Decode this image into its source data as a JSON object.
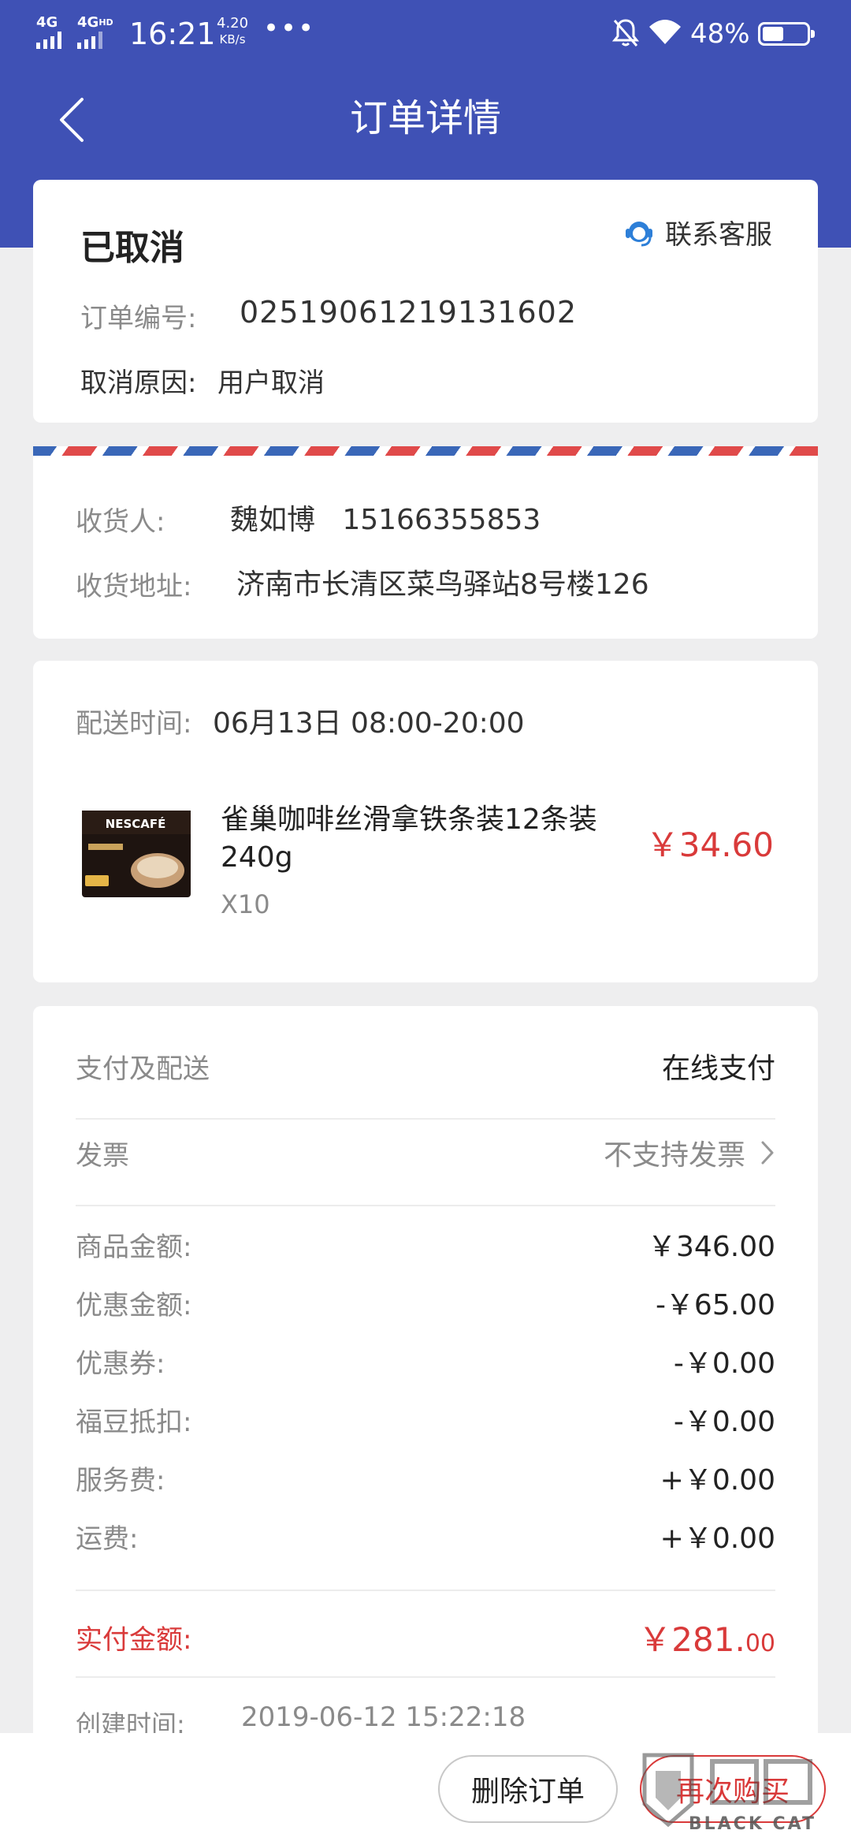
{
  "status_bar": {
    "network1": "4G",
    "network2": "4G",
    "network2_sup": "HD",
    "time": "16:21",
    "speed_value": "4.20",
    "speed_unit": "KB/s",
    "more": "•••",
    "battery_percent": "48%",
    "battery_level": 0.48,
    "icons": [
      "signal-icon",
      "mute-icon",
      "wifi-icon",
      "battery-icon"
    ]
  },
  "nav": {
    "title": "订单详情",
    "back_icon": "chevron-left-icon"
  },
  "order": {
    "status": "已取消",
    "customer_service": "联系客服",
    "order_no_label": "订单编号:",
    "order_no": "02519061219131602",
    "cancel_reason_label": "取消原因:",
    "cancel_reason": "用户取消"
  },
  "address": {
    "receiver_label": "收货人:",
    "receiver": "魏如博   15166355853",
    "address_label": "收货地址:",
    "address": "济南市长清区菜鸟驿站8号楼126"
  },
  "product": {
    "delivery_label": "配送时间:",
    "delivery_time": "06月13日 08:00-20:00",
    "name": "雀巢咖啡丝滑拿铁条装12条装240g",
    "quantity": "X10",
    "price": "￥34.60",
    "thumb_brand": "NESCAFÉ"
  },
  "payment": {
    "pay_method_label": "支付及配送",
    "pay_method": "在线支付",
    "invoice_label": "发票",
    "invoice": "不支持发票",
    "items": [
      {
        "label": "商品金额:",
        "value": "￥346.00"
      },
      {
        "label": "优惠金额:",
        "value": "-￥65.00"
      },
      {
        "label": "优惠券:",
        "value": "-￥0.00"
      },
      {
        "label": "福豆抵扣:",
        "value": "-￥0.00"
      },
      {
        "label": "服务费:",
        "value": "+￥0.00"
      },
      {
        "label": "运费:",
        "value": "+￥0.00"
      }
    ],
    "paid_label": "实付金额:",
    "paid_main": "￥281.",
    "paid_decimal": "00",
    "created_label": "创建时间:",
    "created": "2019-06-12 15:22:18"
  },
  "actions": {
    "delete": "删除订单",
    "rebuy": "再次购买"
  },
  "watermark": {
    "text": "BLACK CAT"
  },
  "colors": {
    "header": "#3f51b5",
    "accent_red": "#d93a3a",
    "background": "#eeeeef"
  }
}
